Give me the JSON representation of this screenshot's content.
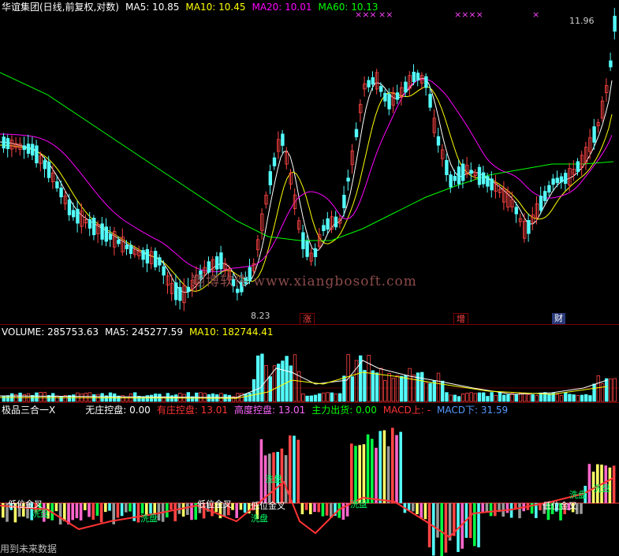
{
  "price_header": {
    "title": "华谊集团(日线,前复权,对数)",
    "ma5": "MA5: 10.85",
    "ma10": "MA10: 10.45",
    "ma20": "MA20: 10.01",
    "ma60": "MA60: 10.13"
  },
  "price_markers": {
    "high": "11.96",
    "low": "8.23",
    "x_marks": [
      "×××",
      "××",
      "××××",
      "×"
    ]
  },
  "tags": [
    "涨",
    "增",
    "财"
  ],
  "watermark": "翔博软件 www.xiangbosoft.com",
  "volume_header": {
    "volume": "VOLUME: 285753.63",
    "ma5": "MA5: 245277.59",
    "ma10": "MA10: 182744.41"
  },
  "indicator_header": {
    "name": "极品三合一X",
    "wuzhuang": "无庄控盘: 0.00",
    "youzhuang": "有庄控盘: 13.01",
    "gaodu": "高度控盘: 13.01",
    "zhuli": "主力出货: 0.00",
    "macd_up": "MACD上: -",
    "macd_down": "MACD下: 31.59"
  },
  "indicator_labels": {
    "low_cross": "低位金叉",
    "wash": "洗盘",
    "low_cross_2": "低位金叉",
    "future_data": "用到未来数据"
  },
  "colors": {
    "background": "#000000",
    "up": "#ff4444",
    "down": "#54fcfc",
    "ma5": "#ffffff",
    "ma10": "#ffff00",
    "ma20": "#ff00ff",
    "ma60": "#00ff00",
    "separator": "#7a0000"
  }
}
